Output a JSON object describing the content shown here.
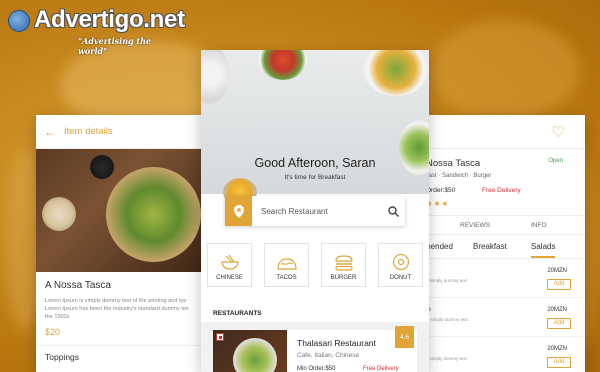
{
  "watermark": {
    "title": "Advertigo.net",
    "tagline": "\"Advertising the world\""
  },
  "left_screen": {
    "header_label": "Item details",
    "title": "A Nossa Tasca",
    "description_lines": [
      "Lorem Ipsum is simply dummy text of the printing and typ",
      "Lorem Ipsum has been the industry's standard dummy tex",
      "the 1500s"
    ],
    "price": "$20",
    "section_label": "Toppings"
  },
  "center_screen": {
    "greeting": "Good Afteroon, Saran",
    "subtitle": "It's time for Breakfast",
    "search_placeholder": "Search Restaurant",
    "categories": [
      {
        "label": "CHINESE",
        "icon": "bowl-icon"
      },
      {
        "label": "TACOS",
        "icon": "taco-icon"
      },
      {
        "label": "BURGER",
        "icon": "burger-icon"
      },
      {
        "label": "DONUT",
        "icon": "donut-icon"
      }
    ],
    "restaurants_heading": "RESTAURANTS",
    "restaurant": {
      "name": "Thalasari Restaurant",
      "cuisines": "Cafe,  Italian,  Chinese",
      "min_order": "Min Order:$50",
      "delivery": "Free Delivery",
      "rating": "4.6"
    }
  },
  "right_screen": {
    "name": "Nossa Tasca",
    "status": "Open",
    "categories": "kfast  ·  Sandwich  ·  Burger",
    "min_order": "Order:$50",
    "delivery": "Free Delivery",
    "stars": "★★★",
    "tabs": [
      "REVIEWS",
      "INFO"
    ],
    "menu_tabs": [
      "mended",
      "Breakfast",
      "Salads"
    ],
    "items": [
      {
        "title": "s",
        "desc": "e simply dummy text",
        "price": "20MZN",
        "action": "Add"
      },
      {
        "title": "lo",
        "desc": "is simply dummy text",
        "price": "20MZN",
        "action": "Add"
      },
      {
        "title": "",
        "desc": "s simply dummy text",
        "price": "20MZN",
        "action": "Add"
      }
    ]
  }
}
